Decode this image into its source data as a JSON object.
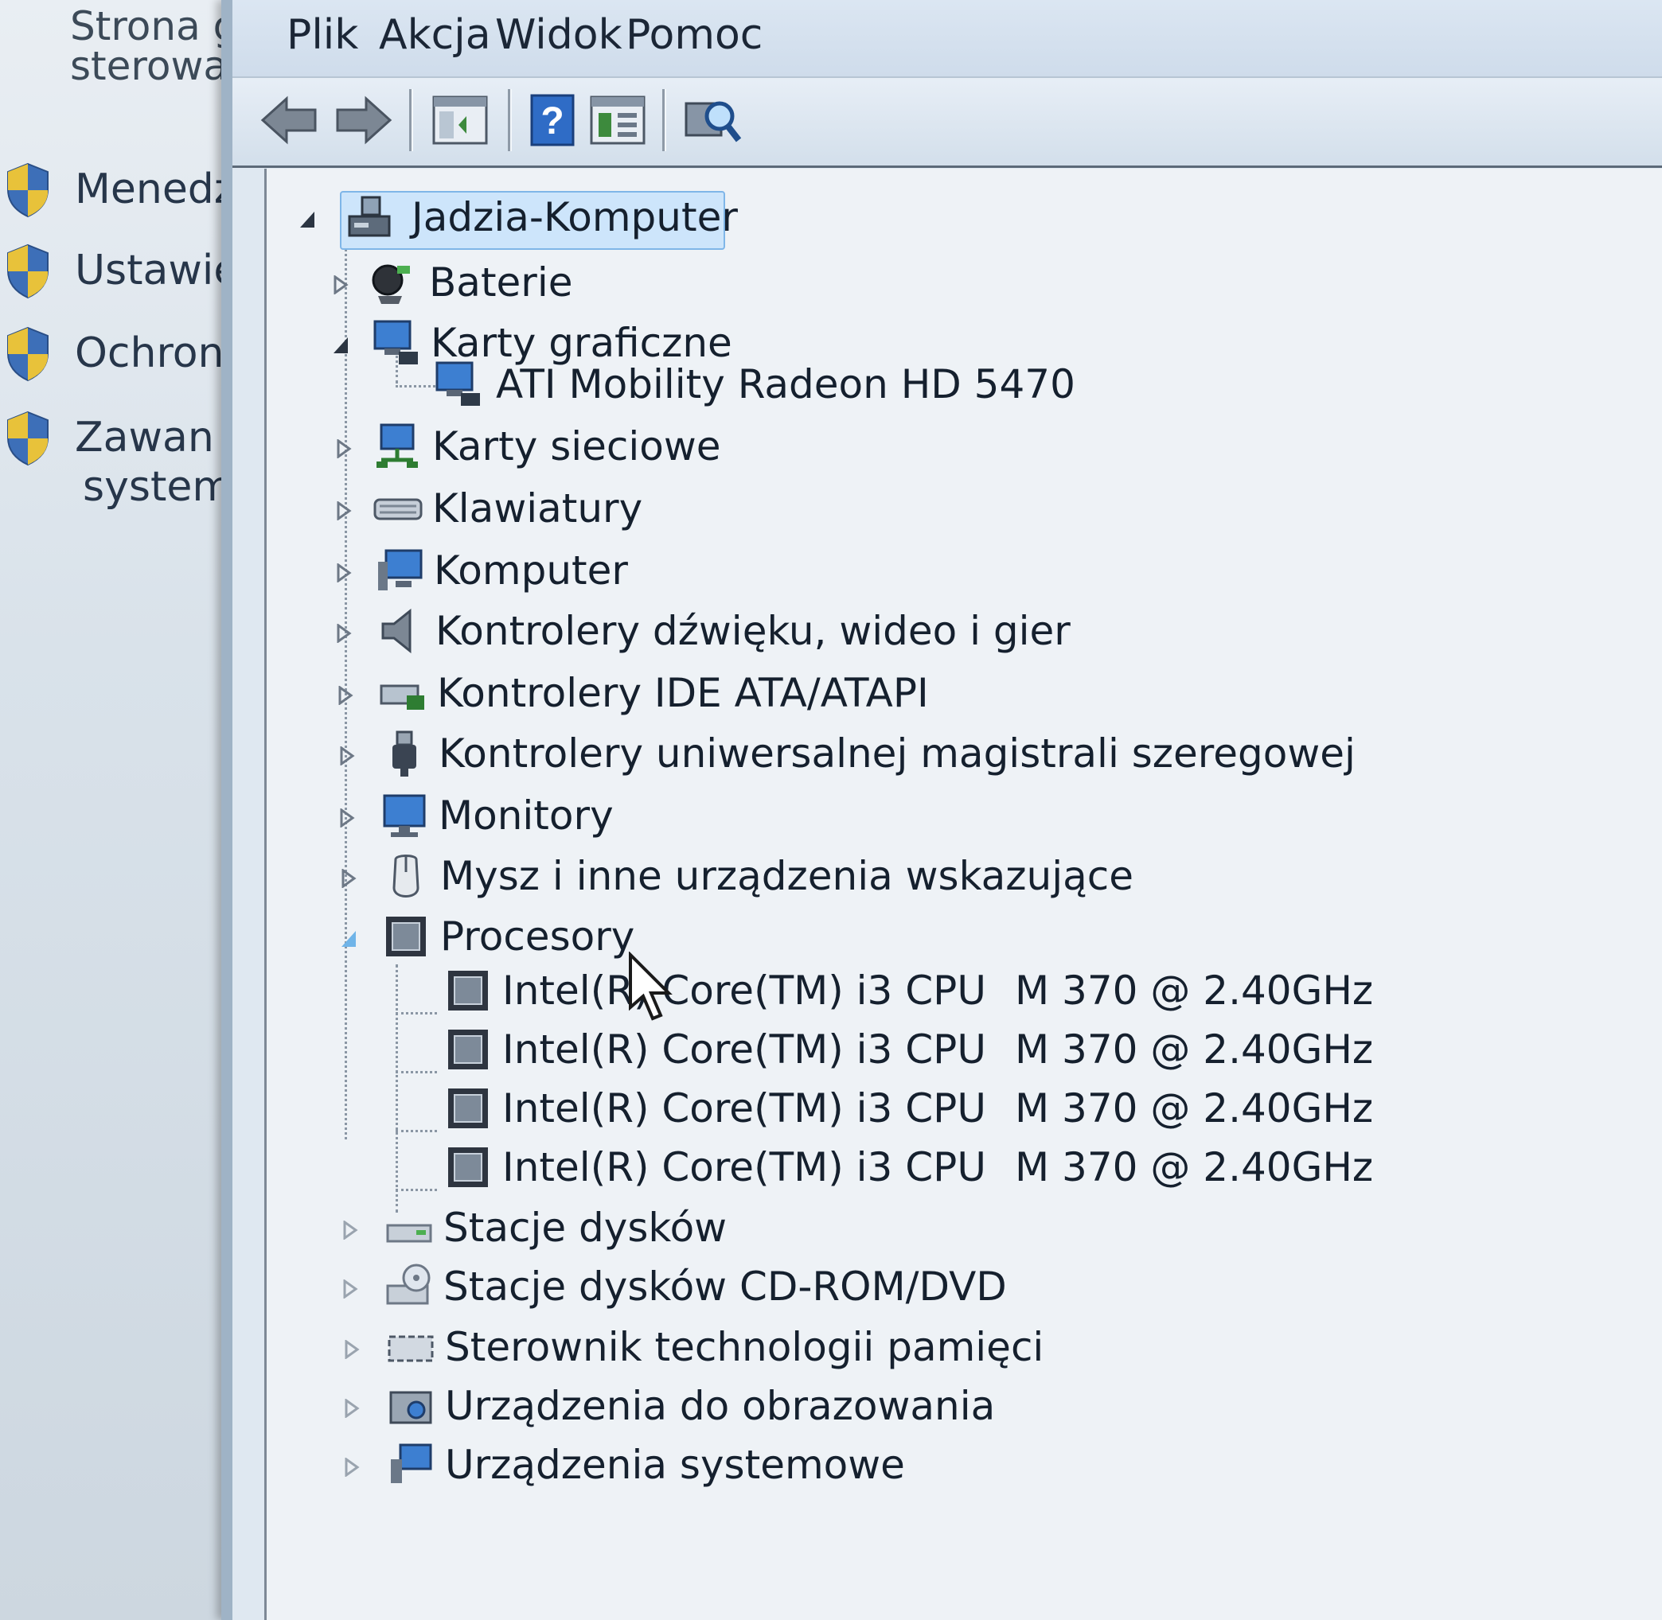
{
  "left_panel": {
    "title_line1": "Strona g",
    "title_line2": "sterowa",
    "items": [
      {
        "label": "Menedż",
        "icon": "uac-shield-icon"
      },
      {
        "label": "Ustawie",
        "icon": "uac-shield-icon"
      },
      {
        "label": "Ochron",
        "icon": "uac-shield-icon"
      },
      {
        "label": "Zawan",
        "label2": "systemu",
        "icon": "uac-shield-icon"
      }
    ]
  },
  "menu": {
    "file": "Plik",
    "action": "Akcja",
    "view": "Widok",
    "help": "Pomoc"
  },
  "toolbar": {
    "buttons": [
      "back-arrow-icon",
      "forward-arrow-icon",
      "show-hide-console-tree-icon",
      "help-icon",
      "properties-icon",
      "scan-hardware-icon"
    ]
  },
  "tree": {
    "root": {
      "label": "Jadzia-Komputer",
      "icon": "computer-icon",
      "expanded": true,
      "selected": true
    },
    "categories": [
      {
        "label": "Baterie",
        "icon": "battery-icon",
        "expanded": false
      },
      {
        "label": "Karty graficzne",
        "icon": "display-adapter-icon",
        "expanded": true,
        "children": [
          {
            "label": "ATI Mobility Radeon HD 5470",
            "icon": "display-adapter-icon"
          }
        ]
      },
      {
        "label": "Karty sieciowe",
        "icon": "network-adapter-icon",
        "expanded": false
      },
      {
        "label": "Klawiatury",
        "icon": "keyboard-icon",
        "expanded": false
      },
      {
        "label": "Komputer",
        "icon": "computer-icon",
        "expanded": false
      },
      {
        "label": "Kontrolery dźwięku, wideo i gier",
        "icon": "speaker-icon",
        "expanded": false
      },
      {
        "label": "Kontrolery IDE ATA/ATAPI",
        "icon": "ide-controller-icon",
        "expanded": false
      },
      {
        "label": "Kontrolery uniwersalnej magistrali szeregowej",
        "icon": "usb-plug-icon",
        "expanded": false
      },
      {
        "label": "Monitory",
        "icon": "monitor-icon",
        "expanded": false
      },
      {
        "label": "Mysz i inne urządzenia wskazujące",
        "icon": "mouse-icon",
        "expanded": false
      },
      {
        "label": "Procesory",
        "icon": "processor-icon",
        "expanded": true,
        "children": [
          {
            "label": "Intel(R) Core(TM) i3 CPU",
            "spec": "M 370  @ 2.40GHz",
            "icon": "processor-icon"
          },
          {
            "label": "Intel(R) Core(TM) i3 CPU",
            "spec": "M 370  @ 2.40GHz",
            "icon": "processor-icon"
          },
          {
            "label": "Intel(R) Core(TM) i3 CPU",
            "spec": "M 370  @ 2.40GHz",
            "icon": "processor-icon"
          },
          {
            "label": "Intel(R) Core(TM) i3 CPU",
            "spec": "M 370  @ 2.40GHz",
            "icon": "processor-icon"
          }
        ]
      },
      {
        "label": "Stacje dysków",
        "icon": "disk-drive-icon",
        "expanded": false
      },
      {
        "label": "Stacje dysków CD-ROM/DVD",
        "icon": "cd-rom-drive-icon",
        "expanded": false
      },
      {
        "label": "Sterownik technologii pamięci",
        "icon": "memory-technology-icon",
        "expanded": false
      },
      {
        "label": "Urządzenia do obrazowania",
        "icon": "imaging-device-icon",
        "expanded": false
      },
      {
        "label": "Urządzenia systemowe",
        "icon": "system-device-icon",
        "expanded": false
      }
    ]
  },
  "colors": {
    "selection": "#cde5fb",
    "tree_background": "#eef2f6",
    "menu_background": "#d6e1ee"
  }
}
